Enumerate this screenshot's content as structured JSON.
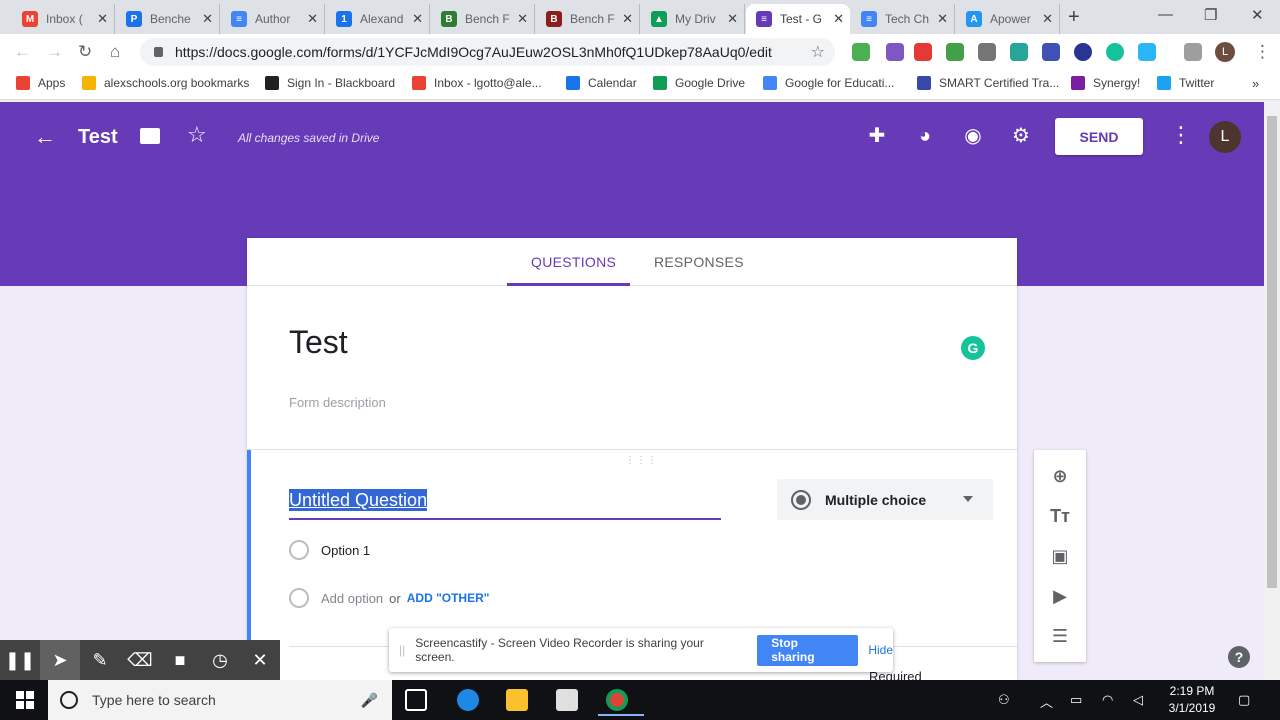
{
  "browser": {
    "tabs": [
      {
        "label": "Inbox (",
        "color": "#ea4335",
        "glyph": "M"
      },
      {
        "label": "Benche",
        "color": "#1a73e8",
        "glyph": "P"
      },
      {
        "label": "Author",
        "color": "#4285f4",
        "glyph": "≡"
      },
      {
        "label": "Alexand",
        "color": "#1a73e8",
        "glyph": "1"
      },
      {
        "label": "Bench F",
        "color": "#2e7d32",
        "glyph": "B"
      },
      {
        "label": "Bench F",
        "color": "#8d1c1c",
        "glyph": "B"
      },
      {
        "label": "My Driv",
        "color": "#0f9d58",
        "glyph": "▲"
      },
      {
        "label": "Test - G",
        "color": "#673ab7",
        "glyph": "≡"
      },
      {
        "label": "Tech Ch",
        "color": "#4285f4",
        "glyph": "≡"
      },
      {
        "label": "Apower",
        "color": "#2196f3",
        "glyph": "A"
      }
    ],
    "url": "https://docs.google.com/forms/d/1YCFJcMdI9Ocg7AuJEuw2OSL3nMh0fQ1UDkep78AaUq0/edit",
    "profile_initial": "L",
    "bookmarks": [
      {
        "label": "Apps",
        "color": "#ea4335"
      },
      {
        "label": "alexschools.org bookmarks",
        "color": "#f4b400"
      },
      {
        "label": "Sign In - Blackboard",
        "color": "#202124"
      },
      {
        "label": "Inbox - lgotto@ale...",
        "color": "#ea4335"
      },
      {
        "label": "Calendar",
        "color": "#1a73e8"
      },
      {
        "label": "Google Drive",
        "color": "#0f9d58"
      },
      {
        "label": "Google for Educati...",
        "color": "#4285f4"
      },
      {
        "label": "SMART Certified Tra...",
        "color": "#3949ab"
      },
      {
        "label": "Synergy!",
        "color": "#7b1fa2"
      },
      {
        "label": "Twitter",
        "color": "#1da1f2"
      }
    ]
  },
  "forms": {
    "title": "Test",
    "saved_status": "All changes saved in Drive",
    "send_label": "SEND",
    "avatar_initial": "L",
    "tabs": {
      "questions": "QUESTIONS",
      "responses": "RESPONSES"
    },
    "form_title": "Test",
    "form_description_placeholder": "Form description",
    "question": {
      "title": "Untitled Question",
      "type": "Multiple choice",
      "option1": "Option 1",
      "add_option": "Add option",
      "or": "or",
      "add_other": "ADD \"OTHER\"",
      "required": "Required"
    }
  },
  "screencastify": {
    "message": "Screencastify - Screen Video Recorder is sharing your screen.",
    "stop_label": "Stop sharing",
    "hide_label": "Hide"
  },
  "taskbar": {
    "search_placeholder": "Type here to search",
    "time": "2:19 PM",
    "date": "3/1/2019"
  },
  "colors": {
    "forms_purple": "#673ab7",
    "accent_blue": "#4285f4"
  }
}
